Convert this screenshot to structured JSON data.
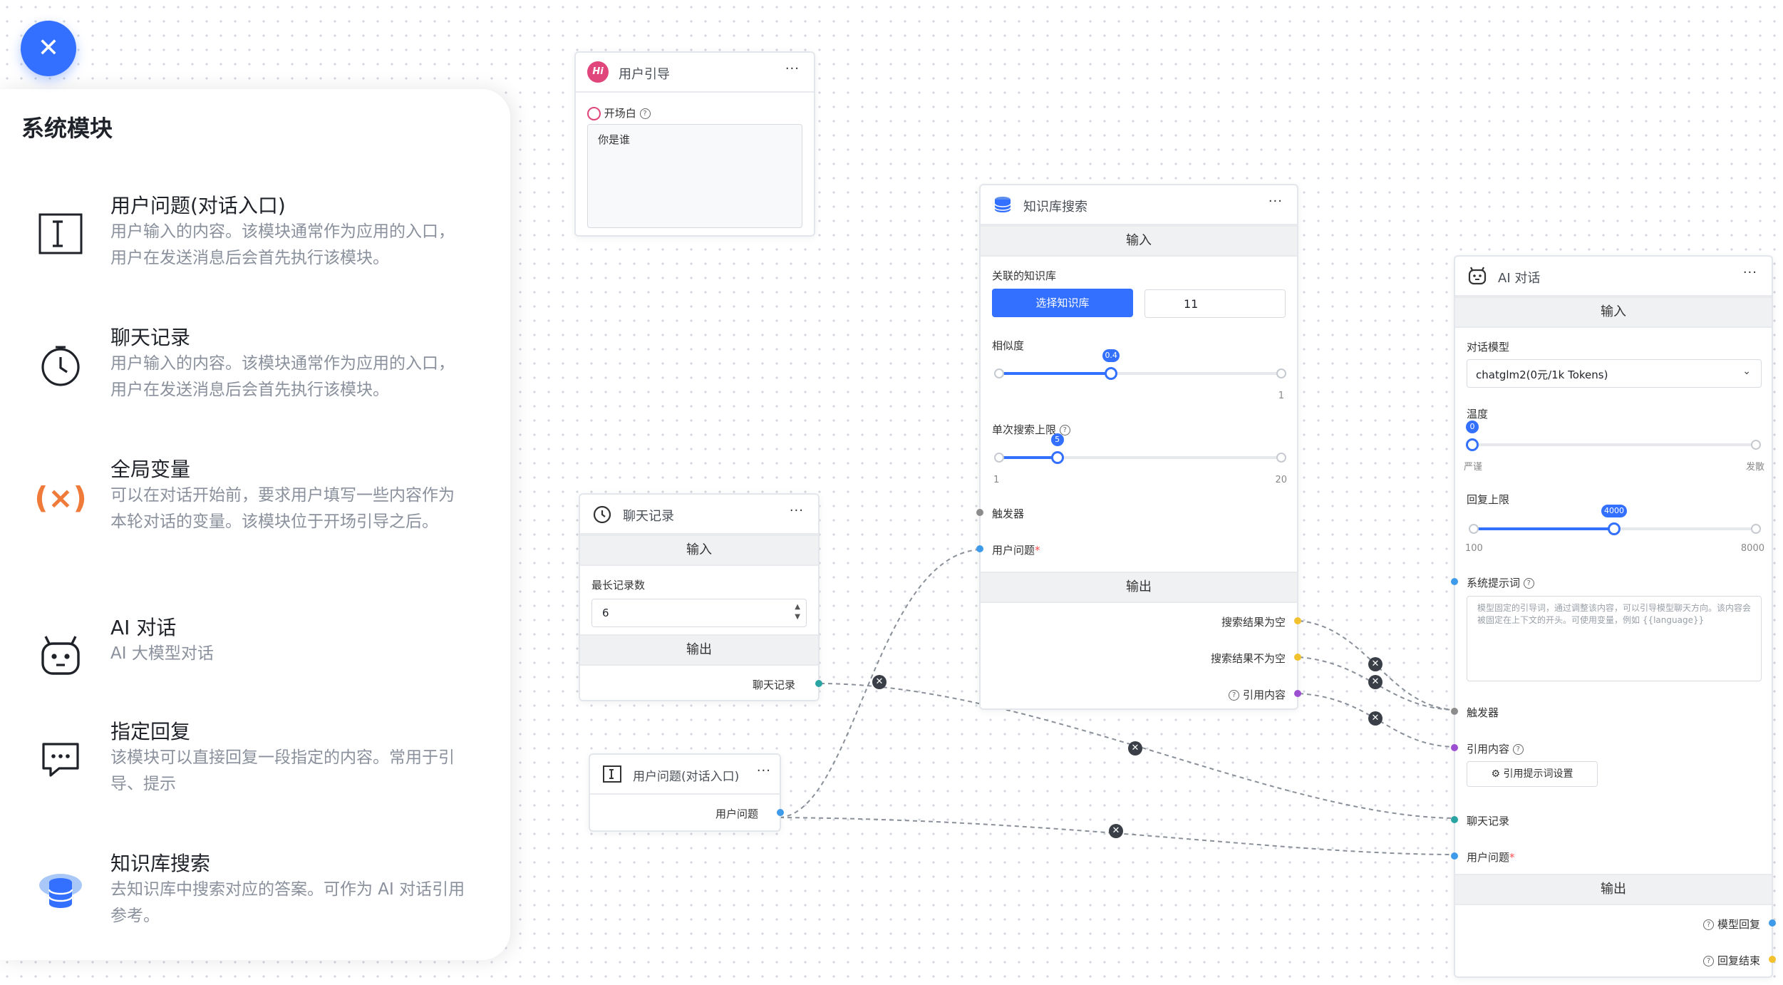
{
  "sidebar": {
    "title": "系统模块",
    "modules": [
      {
        "name": "用户问题(对话入口)",
        "desc": "用户输入的内容。该模块通常作为应用的入口，用户在发送消息后会首先执行该模块。",
        "icon": "text-cursor-icon"
      },
      {
        "name": "聊天记录",
        "desc": "用户输入的内容。该模块通常作为应用的入口，用户在发送消息后会首先执行该模块。",
        "icon": "history-clock-icon"
      },
      {
        "name": "全局变量",
        "desc": "可以在对话开始前，要求用户填写一些内容作为本轮对话的变量。该模块位于开场引导之后。",
        "icon": "variable-icon"
      },
      {
        "name": "AI 对话",
        "desc": "AI 大模型对话",
        "icon": "robot-icon"
      },
      {
        "name": "指定回复",
        "desc": "该模块可以直接回复一段指定的内容。常用于引导、提示",
        "icon": "chat-reply-icon"
      },
      {
        "name": "知识库搜索",
        "desc": "去知识库中搜索对应的答案。可作为 AI 对话引用参考。",
        "icon": "database-icon"
      }
    ]
  },
  "nodes": {
    "guide": {
      "title": "用户引导",
      "icon_text": "Hi",
      "more": "···",
      "opening_label": "开场白",
      "opening_value": "你是谁"
    },
    "history": {
      "title": "聊天记录",
      "more": "···",
      "input_section": "输入",
      "max_label": "最长记录数",
      "max_value": "6",
      "output_section": "输出",
      "output_label": "聊天记录"
    },
    "question": {
      "title": "用户问题(对话入口)",
      "more": "···",
      "output_label": "用户问题"
    },
    "kb": {
      "title": "知识库搜索",
      "more": "···",
      "input_section": "输入",
      "kb_label": "关联的知识库",
      "select_button": "选择知识库",
      "kb_value": "11",
      "similarity_label": "相似度",
      "similarity_value": "0.4",
      "similarity_max": "1",
      "similarity_fraction": 0.4,
      "limit_label": "单次搜索上限",
      "limit_value": "5",
      "limit_min": "1",
      "limit_max": "20",
      "limit_fraction": 0.21,
      "trigger_label": "触发器",
      "question_label": "用户问题",
      "output_section": "输出",
      "out_empty": "搜索结果为空",
      "out_nonempty": "搜索结果不为空",
      "out_quote": "引用内容"
    },
    "ai": {
      "title": "AI 对话",
      "more": "···",
      "input_section": "输入",
      "model_label": "对话模型",
      "model_value": "chatglm2(0元/1k Tokens)",
      "temp_label": "温度",
      "temp_value": "0",
      "temp_min": "严谨",
      "temp_max": "发散",
      "temp_fraction": 0.0,
      "reply_label": "回复上限",
      "reply_value": "4000",
      "reply_min": "100",
      "reply_max": "8000",
      "reply_fraction": 0.5,
      "system_label": "系统提示词",
      "system_placeholder": "模型固定的引导词，通过调整该内容，可以引导模型聊天方向。该内容会被固定在上下文的开头。可使用变量，例如 {{language}}",
      "trigger_label": "触发器",
      "quote_label": "引用内容",
      "quote_button": "引用提示词设置",
      "history_label": "聊天记录",
      "question_label": "用户问题",
      "output_section": "输出",
      "out_reply": "模型回复",
      "out_end": "回复结束"
    }
  },
  "colors": {
    "accent": "#3370ff",
    "port_blue": "#3d9be9",
    "port_teal": "#2aa3a3",
    "port_yellow": "#f2c12e",
    "port_purple": "#9c4fd1",
    "port_gray": "#8c8c8c",
    "variable_orange": "#f07a3a",
    "guide_pink": "#e0457b"
  }
}
